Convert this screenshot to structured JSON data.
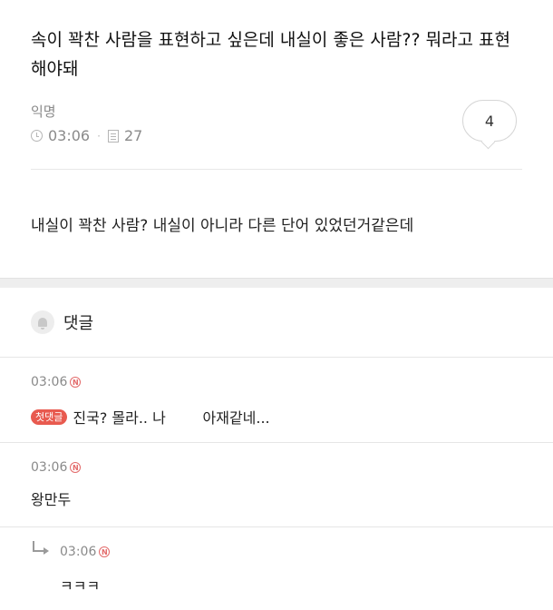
{
  "post": {
    "title": "속이 꽉찬 사람을 표현하고 싶은데 내실이 좋은 사람?? 뭐라고 표현해야돼",
    "author": "익명",
    "time": "03:06",
    "views": "27",
    "comment_count": "4",
    "body": "내실이 꽉찬 사람? 내실이 아니라 다른 단어 있었던거같은데"
  },
  "comments_section": {
    "title": "댓글"
  },
  "comments": [
    {
      "time": "03:06",
      "new_badge": "N",
      "first_badge": "첫댓글",
      "text": "진국? 몰라.. 나        아재같네..."
    },
    {
      "time": "03:06",
      "new_badge": "N",
      "text": "왕만두"
    },
    {
      "time": "03:06",
      "new_badge": "N",
      "text": "ㅋㅋㅋ",
      "is_reply": true
    }
  ]
}
